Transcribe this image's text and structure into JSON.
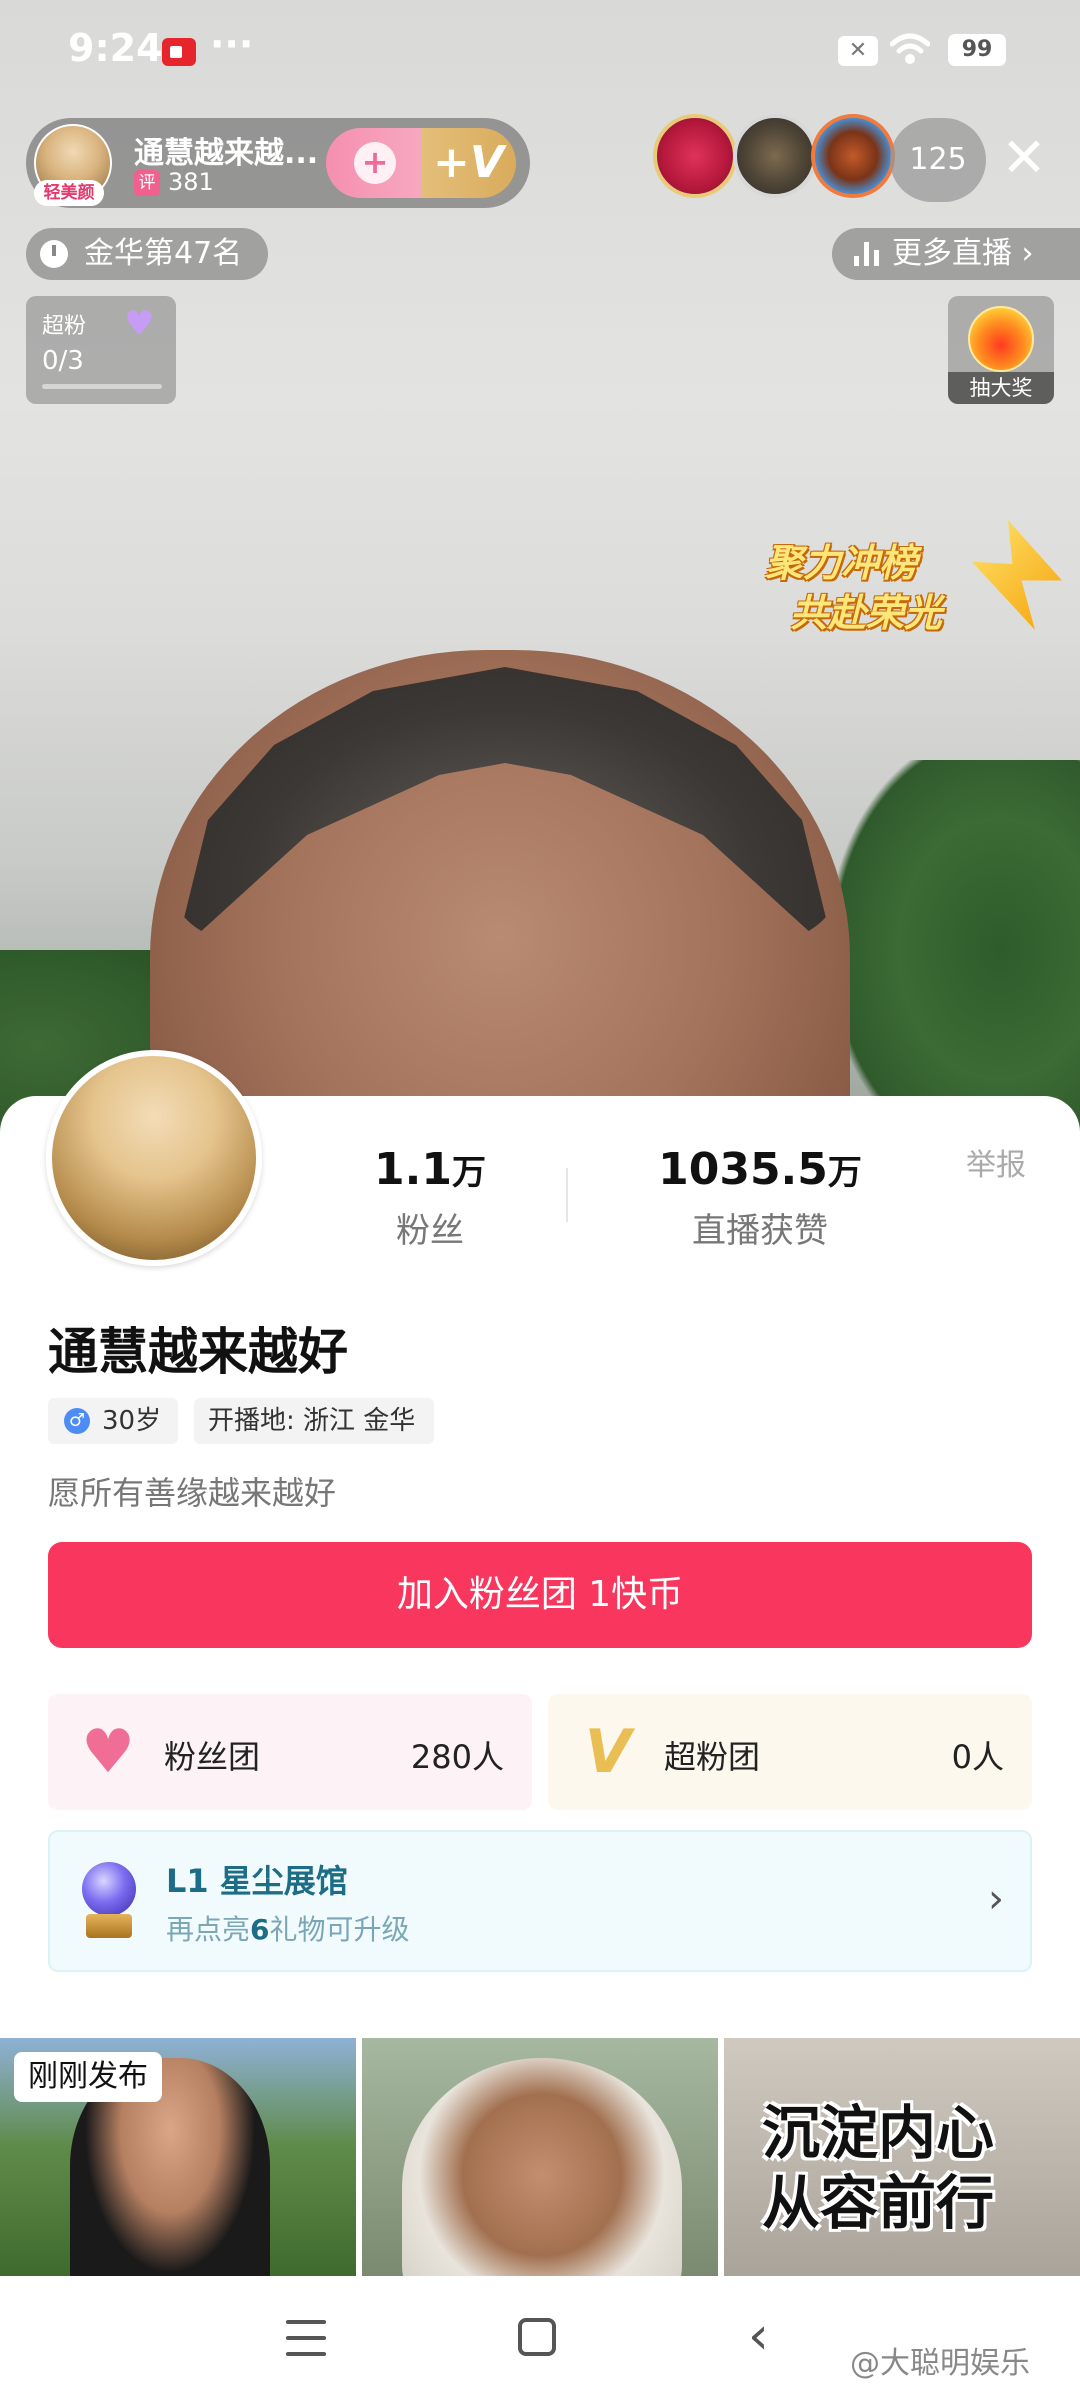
{
  "status_bar": {
    "time": "9:24",
    "more": "···",
    "battery": "99"
  },
  "live_header": {
    "host_name": "通慧越来越...",
    "beauty_tag": "轻美颜",
    "score_icon": "评",
    "score": "381",
    "viewer_count": "125",
    "close_glyph": "✕",
    "rank_text": "金华第47名",
    "more_live": "更多直播 ›",
    "superfan_label": "超粉",
    "superfan_progress": "0/3",
    "lottery_label": "抽大奖",
    "promo_line1": "聚力冲榜",
    "promo_line2": "共赴荣光"
  },
  "profile": {
    "fans_value": "1.1",
    "fans_unit": "万",
    "fans_label": "粉丝",
    "likes_value": "1035.5",
    "likes_unit": "万",
    "likes_label": "直播获赞",
    "report": "举报",
    "name": "通慧越来越好",
    "gender_icon": "♂",
    "age": "30岁",
    "location": "开播地: 浙江 金华",
    "bio": "愿所有善缘越来越好",
    "join_button": "加入粉丝团 1快币",
    "fan_club_label": "粉丝团",
    "fan_club_count": "280人",
    "super_club_label": "超粉团",
    "super_club_count": "0人",
    "gallery_title": "L1 星尘展馆",
    "gallery_sub_pre": "再点亮",
    "gallery_sub_num": "6",
    "gallery_sub_post": "礼物可升级",
    "just_posted": "刚刚发布",
    "thumb3_line1": "沉淀内心",
    "thumb3_line2": "从容前行"
  },
  "nav": {
    "watermark": "@大聪明娱乐"
  },
  "icons": {
    "heart": "♥",
    "chevron": "›",
    "back": "‹"
  },
  "colors": {
    "accent_pink": "#f9375e",
    "gallery_blue": "#1d6d86"
  }
}
